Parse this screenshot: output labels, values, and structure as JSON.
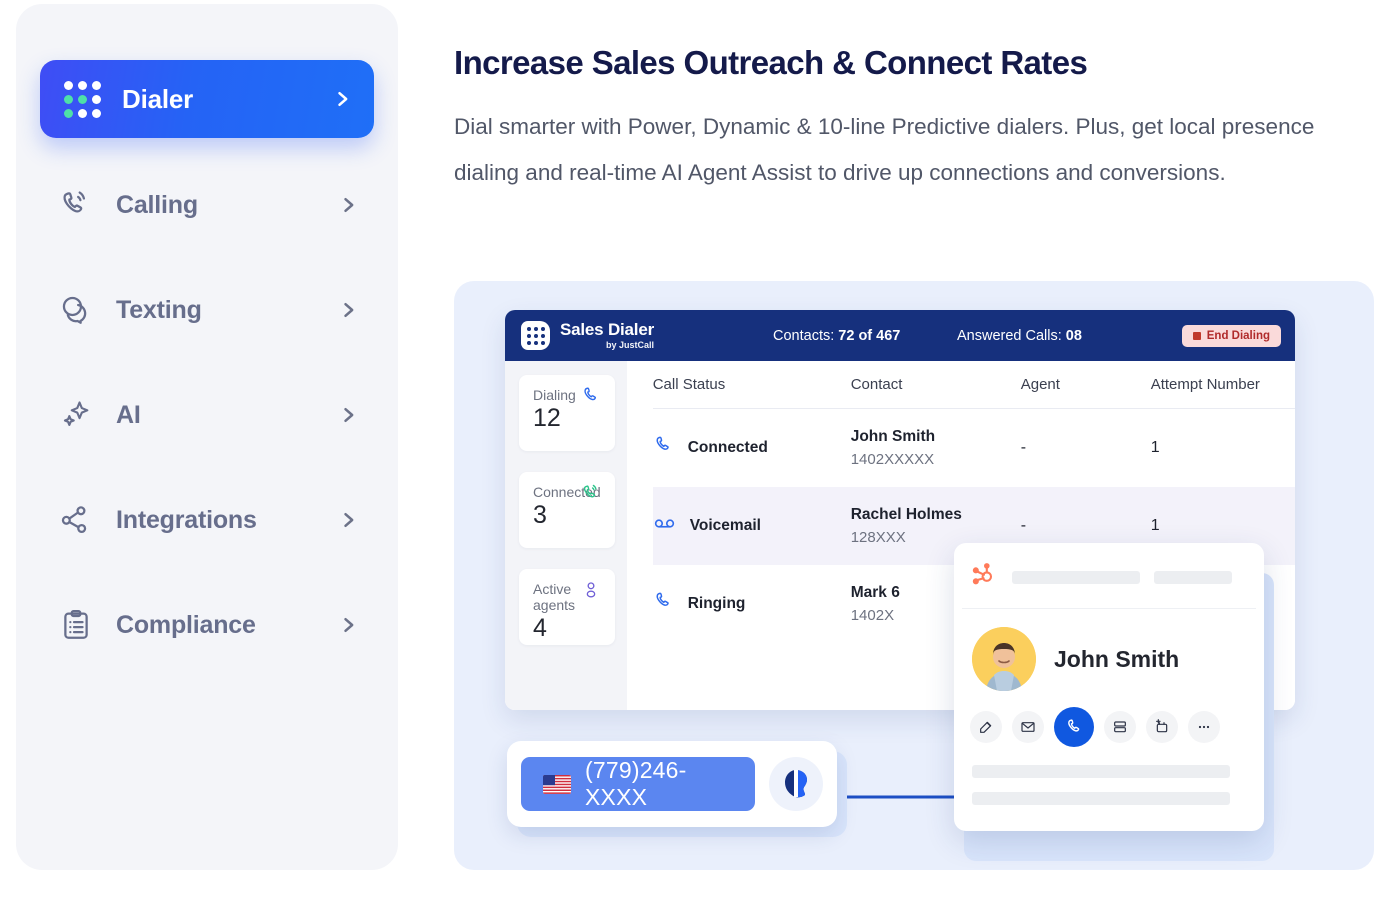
{
  "sidebar": {
    "items": [
      {
        "label": "Dialer",
        "icon": "dot-grid-icon",
        "active": true
      },
      {
        "label": "Calling",
        "icon": "phone-ring-icon",
        "active": false
      },
      {
        "label": "Texting",
        "icon": "chat-bubbles-icon",
        "active": false
      },
      {
        "label": "AI",
        "icon": "sparkle-icon",
        "active": false
      },
      {
        "label": "Integrations",
        "icon": "node-graph-icon",
        "active": false
      },
      {
        "label": "Compliance",
        "icon": "clipboard-list-icon",
        "active": false
      }
    ],
    "chevron_icon": "chevron-right-icon"
  },
  "content": {
    "headline": "Increase Sales Outreach & Connect Rates",
    "subtext": "Dial smarter with Power, Dynamic & 10-line Predictive dialers. Plus, get local presence dialing and real-time AI Agent Assist to drive up connections and conversions."
  },
  "dialer": {
    "brand_name": "Sales Dialer",
    "brand_sub": "by JustCall",
    "brand_icon": "dot-grid-icon",
    "contacts_label": "Contacts:",
    "contacts_value": "72 of 467",
    "answered_label": "Answered Calls:",
    "answered_value": "08",
    "end_button": "End Dialing",
    "end_icon": "stop-square-icon",
    "stats": [
      {
        "label": "Dialing",
        "value": "12",
        "icon": "phone-icon",
        "color": "#2f6bed"
      },
      {
        "label": "Connected",
        "value": "3",
        "icon": "phone-connected-icon",
        "color": "#2bc48a"
      },
      {
        "label": "Active agents",
        "value": "4",
        "icon": "user-icon",
        "color": "#6f5fd6"
      }
    ],
    "table": {
      "columns": [
        "Call Status",
        "Contact",
        "Agent",
        "Attempt Number"
      ],
      "rows": [
        {
          "status": "Connected",
          "status_icon": "phone-icon",
          "name": "John Smith",
          "number": "1402XXXXX",
          "agent": "-",
          "attempt": "1"
        },
        {
          "status": "Voicemail",
          "status_icon": "voicemail-icon",
          "name": "Rachel Holmes",
          "number": "128XXX",
          "agent": "-",
          "attempt": "1"
        },
        {
          "status": "Ringing",
          "status_icon": "phone-icon",
          "name": "Mark 6",
          "number": "1402X",
          "agent": "",
          "attempt": ""
        }
      ]
    }
  },
  "crm_card": {
    "logo_icon": "hubspot-icon",
    "contact_name": "John Smith",
    "avatar_icon": "user-photo-avatar",
    "actions": [
      {
        "icon": "edit-note-icon",
        "active": false
      },
      {
        "icon": "email-icon",
        "active": false
      },
      {
        "icon": "call-icon",
        "active": true
      },
      {
        "icon": "database-icon",
        "active": false
      },
      {
        "icon": "add-task-icon",
        "active": false
      },
      {
        "icon": "more-options-icon",
        "active": false
      }
    ]
  },
  "phone_bar": {
    "flag_icon": "us-flag-icon",
    "number": "(779)246-XXXX",
    "badge_icon": "justcall-logo-icon"
  },
  "colors": {
    "accent_blue": "#2563f5",
    "header_navy": "#16307d",
    "panel_bg": "#e9effc",
    "sidebar_bg": "#f4f5f9",
    "heading": "#141a4a",
    "green": "#2bc48a",
    "hubspot_orange": "#ff7a59",
    "end_pill_bg": "#fadada",
    "end_pill_text": "#b02a2a"
  }
}
